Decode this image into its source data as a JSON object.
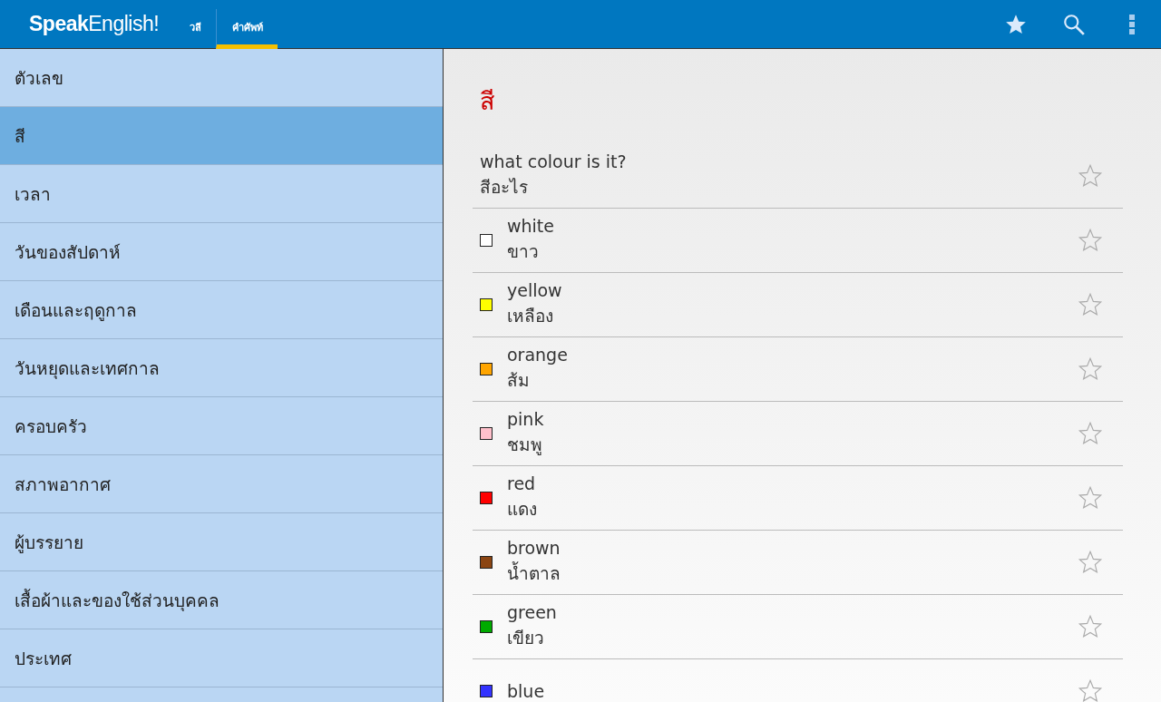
{
  "app_bar": {
    "logo": "**Speak**English!",
    "tabs": [
      {
        "label": "วลี",
        "selected": false
      },
      {
        "label": "คำศัพท์",
        "selected": true
      }
    ]
  },
  "sidebar": {
    "items": [
      {
        "label": "ตัวเลข",
        "selected": false
      },
      {
        "label": "สี",
        "selected": true
      },
      {
        "label": "เวลา",
        "selected": false
      },
      {
        "label": "วันของสัปดาห์",
        "selected": false
      },
      {
        "label": "เดือนและฤดูกาล",
        "selected": false
      },
      {
        "label": "วันหยุดและเทศกาล",
        "selected": false
      },
      {
        "label": "ครอบครัว",
        "selected": false
      },
      {
        "label": "สภาพอากาศ",
        "selected": false
      },
      {
        "label": "ผู้บรรยาย",
        "selected": false
      },
      {
        "label": "เสื้อผ้าและของใช้ส่วนบุคคล",
        "selected": false
      },
      {
        "label": "ประเทศ",
        "selected": false
      }
    ]
  },
  "content": {
    "title": "สี",
    "entries": [
      {
        "kind": "phrase",
        "english": "what colour is it?",
        "thai": "สีอะไร",
        "starred": false
      },
      {
        "kind": "color",
        "english": "white",
        "thai": "ขาว",
        "color": "#ffffff",
        "starred": false
      },
      {
        "kind": "color",
        "english": "yellow",
        "thai": "เหลือง",
        "color": "#ffff00",
        "starred": false
      },
      {
        "kind": "color",
        "english": "orange",
        "thai": "ส้ม",
        "color": "#ffa500",
        "starred": false
      },
      {
        "kind": "color",
        "english": "pink",
        "thai": "ชมพู",
        "color": "#ffc0cb",
        "starred": false
      },
      {
        "kind": "color",
        "english": "red",
        "thai": "แดง",
        "color": "#ff0000",
        "starred": false
      },
      {
        "kind": "color",
        "english": "brown",
        "thai": "น้ำตาล",
        "color": "#8b4513",
        "starred": false
      },
      {
        "kind": "color",
        "english": "green",
        "thai": "เขียว",
        "color": "#00aa00",
        "starred": false
      },
      {
        "kind": "color",
        "english": "blue",
        "color": "#3333ff",
        "starred": false
      }
    ]
  }
}
